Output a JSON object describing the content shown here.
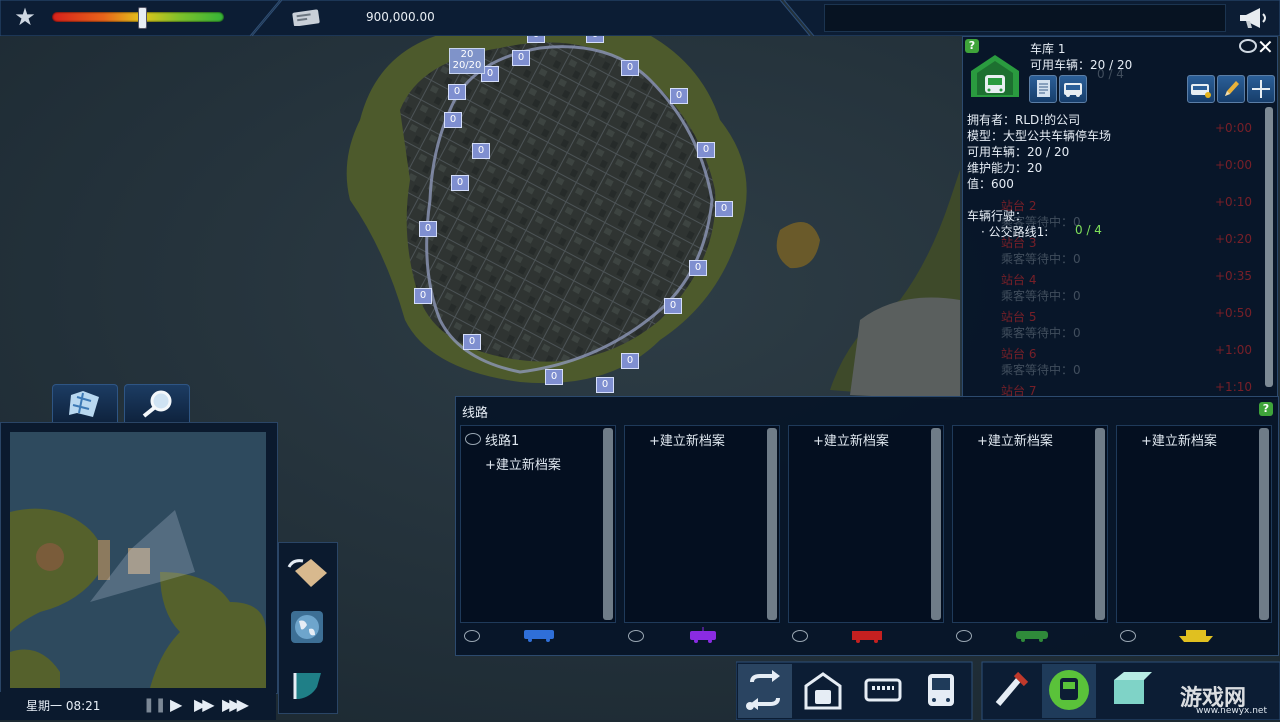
{
  "topbar": {
    "money": "900,000.00",
    "approval_fraction": 0.52
  },
  "map_labels": [
    {
      "v": "0"
    },
    {
      "v": "0"
    },
    {
      "v": "0"
    },
    {
      "v": "0"
    },
    {
      "v": "0"
    },
    {
      "v": "0"
    },
    {
      "v": "0"
    },
    {
      "v": "0"
    },
    {
      "v": "0"
    },
    {
      "v": "0"
    },
    {
      "v": "0"
    },
    {
      "v": "0"
    },
    {
      "v": "0"
    },
    {
      "v": "0"
    },
    {
      "v": "0"
    },
    {
      "v": "0"
    },
    {
      "v": "0"
    },
    {
      "v": "0"
    },
    {
      "v": "0"
    },
    {
      "v": "0"
    }
  ],
  "depot_marker": {
    "top": "20",
    "bottom": "20/20"
  },
  "depot": {
    "name": "车库 1",
    "available": "可用车辆：20 / 20",
    "owner": "拥有者：RLD!的公司",
    "model": "模型：大型公共车辆停车场",
    "available2": "可用车辆：20 / 20",
    "maintenance": "维护能力：20",
    "value": "值：600",
    "vehicles_driving": "车辆行驶：",
    "route_label": "· 公交路线1:",
    "route_value": "0 / 4",
    "help": "?",
    "ghost_right": [
      "+0:00",
      "+0:00",
      "+0:10",
      "+0:20",
      "+0:35",
      "+0:50",
      "+1:00",
      "+1:10"
    ],
    "ghost_ratio": "0 / 4",
    "ghost_stations": [
      {
        "name": "站台 2",
        "sub": "乘客等待中：0"
      },
      {
        "name": "站台 3",
        "sub": "乘客等待中：0"
      },
      {
        "name": "站台 4",
        "sub": "乘客等待中：0"
      },
      {
        "name": "站台 5",
        "sub": "乘客等待中：0"
      },
      {
        "name": "站台 6",
        "sub": "乘客等待中：0"
      },
      {
        "name": "站台 7",
        "sub": ""
      }
    ],
    "ghost_top": [
      "乘客等待中：0",
      "乘客等待中：0"
    ]
  },
  "lines": {
    "title": "线路",
    "help": "?",
    "columns": [
      {
        "header": "线路1",
        "new": "+建立新档案",
        "vehicle": "bus",
        "color": "#2f6fd8"
      },
      {
        "header": "",
        "new": "+建立新档案",
        "vehicle": "tram",
        "color": "#8a2be2"
      },
      {
        "header": "",
        "new": "+建立新档案",
        "vehicle": "train",
        "color": "#c42020"
      },
      {
        "header": "",
        "new": "+建立新档案",
        "vehicle": "metro",
        "color": "#2f8a3a"
      },
      {
        "header": "",
        "new": "+建立新档案",
        "vehicle": "ferry",
        "color": "#e0c020"
      }
    ]
  },
  "clock": {
    "text": "星期一 08:21"
  },
  "watermark": {
    "text": "游戏网",
    "url": "www.newyx.net"
  },
  "icons": {
    "star": "star-icon",
    "money": "banknote-icon",
    "megaphone": "megaphone-icon",
    "depot": "bus-garage-icon",
    "info": "info-sheet-icon",
    "bus": "bus-icon",
    "edit": "pencil-icon",
    "move": "crosshair-icon",
    "close": "close-icon",
    "eye": "eye-icon",
    "map": "map-icon",
    "magnifier": "magnifier-icon",
    "terrain": "terrain-icon",
    "globe": "globe-icon",
    "flag": "flag-icon",
    "pause": "pause-icon",
    "play": "play-icon",
    "fast": "fast-forward-icon",
    "fastest": "fastest-forward-icon",
    "routes": "routes-icon",
    "garage": "garage-icon",
    "stop": "bus-stop-icon",
    "vehicle": "bus-front-icon",
    "tools": "tools-icon",
    "active_bus": "active-bus-icon",
    "box": "box-icon"
  }
}
